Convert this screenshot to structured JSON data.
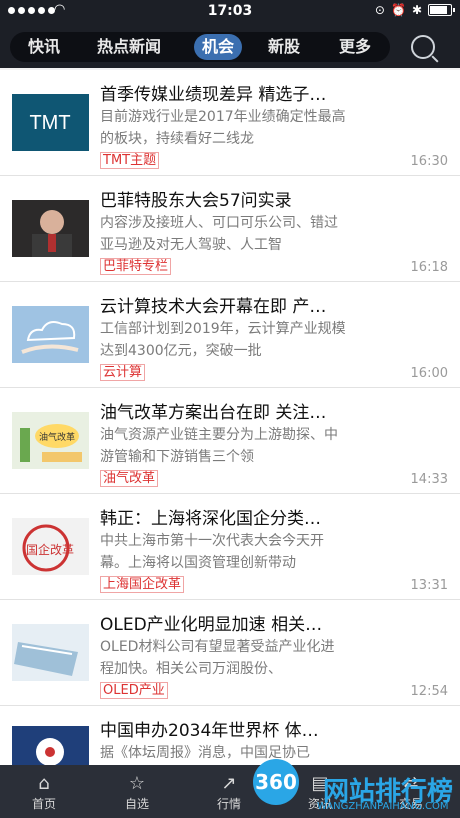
{
  "status": {
    "time": "17:03"
  },
  "nav": {
    "tabs": [
      {
        "label": "快讯"
      },
      {
        "label": "热点新闻"
      },
      {
        "label": "机会"
      },
      {
        "label": "新股"
      },
      {
        "label": "更多"
      }
    ],
    "active_tab": "机会",
    "search_icon": "search-icon",
    "accent": "#3b6fb0"
  },
  "articles": [
    {
      "title": "首季传媒业绩现差异 精选子…",
      "summary": "目前游戏行业是2017年业绩确定性最高的板块，持续看好二线龙",
      "tag": "TMT主题",
      "time": "16:30",
      "thumb_text": "TMT"
    },
    {
      "title": "巴菲特股东大会57问实录",
      "summary": "内容涉及接班人、可口可乐公司、错过亚马逊及对无人驾驶、人工智",
      "tag": "巴菲特专栏",
      "time": "16:18"
    },
    {
      "title": "云计算技术大会开幕在即 产…",
      "summary": "工信部计划到2019年，云计算产业规模达到4300亿元，突破一批",
      "tag": "云计算",
      "time": "16:00"
    },
    {
      "title": "油气改革方案出台在即 关注…",
      "summary": "油气资源产业链主要分为上游勘探、中游管输和下游销售三个领",
      "tag": "油气改革",
      "time": "14:33",
      "thumb_text": "油气改革"
    },
    {
      "title": "韩正：上海将深化国企分类…",
      "summary": "中共上海市第十一次代表大会今天开幕。上海将以国资管理创新带动",
      "tag": "上海国企改革",
      "time": "13:31",
      "thumb_text": "国企改革"
    },
    {
      "title": "OLED产业化明显加速 相关…",
      "summary": "OLED材料公司有望显著受益产业化进程加快。相关公司万润股份、",
      "tag": "OLED产业",
      "time": "12:54"
    },
    {
      "title": "中国申办2034年世界杯 体…",
      "summary": "据《体坛周报》消息，中国足协已",
      "tag": "",
      "time": ""
    }
  ],
  "bottom_nav": [
    {
      "label": "首页",
      "icon": "home-icon"
    },
    {
      "label": "自选",
      "icon": "star-icon"
    },
    {
      "label": "行情",
      "icon": "chart-icon"
    },
    {
      "label": "资讯",
      "icon": "news-icon"
    },
    {
      "label": "交易",
      "icon": "trade-icon"
    }
  ],
  "watermark": {
    "circle_text": "360",
    "big_text": "网站排行榜",
    "small_text": "WANGZHANPAIHANG.COM"
  }
}
